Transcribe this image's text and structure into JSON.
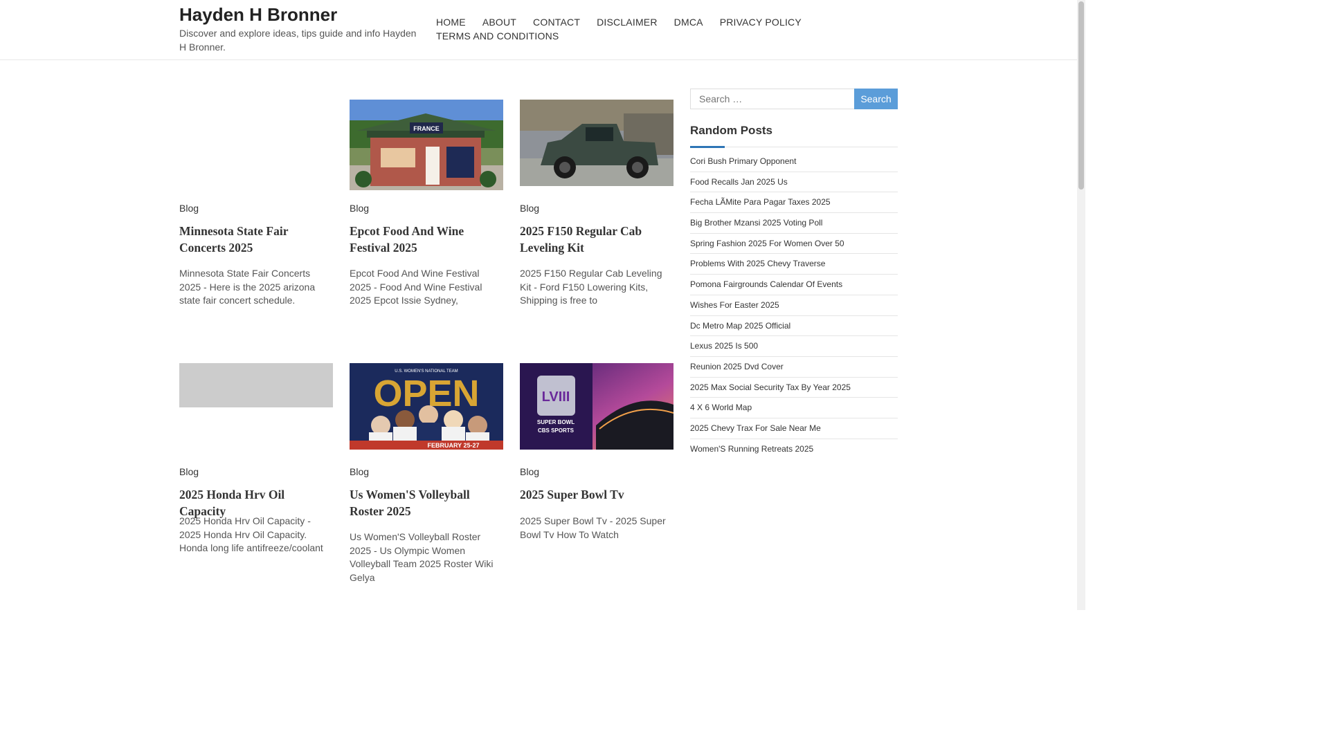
{
  "header": {
    "title": "Hayden H Bronner",
    "description": "Discover and explore ideas, tips guide and info Hayden H Bronner."
  },
  "nav": [
    "HOME",
    "ABOUT",
    "CONTACT",
    "DISCLAIMER",
    "DMCA",
    "PRIVACY POLICY",
    "TERMS AND CONDITIONS"
  ],
  "posts": [
    {
      "category": "Blog",
      "title": "Minnesota State Fair Concerts 2025",
      "excerpt": "Minnesota State Fair Concerts 2025 - Here is the 2025 arizona state fair concert schedule."
    },
    {
      "category": "Blog",
      "title": "Epcot Food And Wine Festival 2025",
      "excerpt": "Epcot Food And Wine Festival 2025 - Food And Wine Festival 2025 Epcot Issie Sydney,",
      "image_text": "FRANCE"
    },
    {
      "category": "Blog",
      "title": "2025 F150 Regular Cab Leveling Kit",
      "excerpt": "2025 F150 Regular Cab Leveling Kit - Ford F150 Lowering Kits, Shipping is free to"
    },
    {
      "category": "Blog",
      "title": "2025 Honda Hrv Oil Capacity",
      "excerpt": "2025 Honda Hrv Oil Capacity - 2025 Honda Hrv Oil Capacity. Honda long life antifreeze/coolant"
    },
    {
      "category": "Blog",
      "title": "Us Women'S Volleyball Roster 2025",
      "excerpt": "Us Women'S Volleyball Roster 2025 - Us Olympic Women Volleyball Team 2025 Roster Wiki Gelya",
      "image_text": {
        "top": "U.S. WOMEN'S NATIONAL TEAM",
        "big": "OPEN",
        "bottom": "FEBRUARY 25-27"
      }
    },
    {
      "category": "Blog",
      "title": "2025 Super Bowl Tv",
      "excerpt": "2025 Super Bowl Tv - 2025 Super Bowl Tv How To Watch",
      "image_text": {
        "logo": "LVIII",
        "sub": "SUPER BOWL",
        "network": "CBS SPORTS"
      }
    }
  ],
  "search": {
    "placeholder": "Search …",
    "button": "Search"
  },
  "sidebar": {
    "widget_title": "Random Posts",
    "items": [
      "Cori Bush Primary Opponent",
      "Food Recalls Jan 2025 Us",
      "Fecha LÃMite Para Pagar Taxes 2025",
      "Big Brother Mzansi 2025 Voting Poll",
      "Spring Fashion 2025 For Women Over 50",
      "Problems With 2025 Chevy Traverse",
      "Pomona Fairgrounds Calendar Of Events",
      "Wishes For Easter 2025",
      "Dc Metro Map 2025 Official",
      "Lexus 2025 Is 500",
      "Reunion 2025 Dvd Cover",
      "2025 Max Social Security Tax By Year 2025",
      "4 X 6 World Map",
      "2025 Chevy Trax For Sale Near Me",
      "Women'S Running Retreats 2025"
    ]
  },
  "colors": {
    "accent": "#2e75b6",
    "search_button": "#5b9dd9"
  }
}
